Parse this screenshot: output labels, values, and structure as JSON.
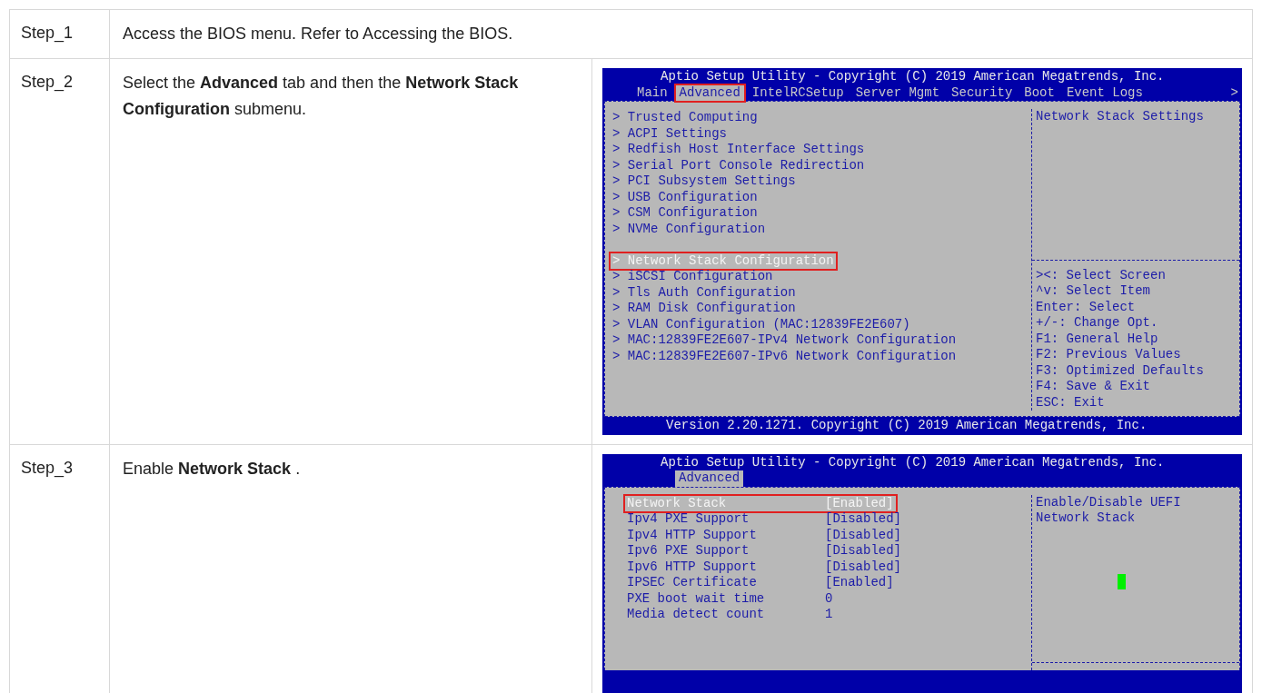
{
  "steps": [
    {
      "label": "Step_1",
      "text": "Access the BIOS menu. Refer to Accessing the BIOS."
    },
    {
      "label": "Step_2",
      "text": "Select the **Advanced** tab and then the **Network Stack Configuration** submenu.",
      "screen": {
        "kind": "menu",
        "title": "Aptio Setup Utility - Copyright (C) 2019 American Megatrends, Inc.",
        "tabs": [
          {
            "label": "Main",
            "selected": false,
            "marked": false
          },
          {
            "label": "Advanced",
            "selected": true,
            "marked": true
          },
          {
            "label": "IntelRCSetup",
            "selected": false,
            "marked": false
          },
          {
            "label": "Server Mgmt",
            "selected": false,
            "marked": false
          },
          {
            "label": "Security",
            "selected": false,
            "marked": false
          },
          {
            "label": "Boot",
            "selected": false,
            "marked": false
          },
          {
            "label": "Event Logs",
            "selected": false,
            "marked": false
          }
        ],
        "more_tabs": ">",
        "items": [
          {
            "kind": "submenu",
            "label": "> Trusted Computing",
            "selected": false,
            "marked": false
          },
          {
            "kind": "submenu",
            "label": "> ACPI Settings",
            "selected": false,
            "marked": false
          },
          {
            "kind": "submenu",
            "label": "> Redfish Host Interface Settings",
            "selected": false,
            "marked": false
          },
          {
            "kind": "submenu",
            "label": "> Serial Port Console Redirection",
            "selected": false,
            "marked": false
          },
          {
            "kind": "submenu",
            "label": "> PCI Subsystem Settings",
            "selected": false,
            "marked": false
          },
          {
            "kind": "submenu",
            "label": "> USB Configuration",
            "selected": false,
            "marked": false
          },
          {
            "kind": "submenu",
            "label": "> CSM Configuration",
            "selected": false,
            "marked": false
          },
          {
            "kind": "submenu",
            "label": "> NVMe Configuration",
            "selected": false,
            "marked": false
          },
          {
            "kind": "spacer"
          },
          {
            "kind": "submenu",
            "label": "> Network Stack Configuration",
            "selected": true,
            "marked": true
          },
          {
            "kind": "submenu",
            "label": "> iSCSI Configuration",
            "selected": false,
            "marked": false
          },
          {
            "kind": "submenu",
            "label": "> Tls Auth Configuration",
            "selected": false,
            "marked": false
          },
          {
            "kind": "submenu",
            "label": "> RAM Disk Configuration",
            "selected": false,
            "marked": false
          },
          {
            "kind": "submenu",
            "label": "> VLAN Configuration (MAC:12839FE2E607)",
            "selected": false,
            "marked": false
          },
          {
            "kind": "submenu",
            "label": "> MAC:12839FE2E607-IPv4 Network Configuration",
            "selected": false,
            "marked": false
          },
          {
            "kind": "submenu",
            "label": "> MAC:12839FE2E607-IPv6 Network Configuration",
            "selected": false,
            "marked": false
          }
        ],
        "help": [
          "Network Stack Settings"
        ],
        "keys": [
          "><: Select Screen",
          "^v: Select Item",
          "Enter: Select",
          "+/-: Change Opt.",
          "F1: General Help",
          "F2: Previous Values",
          "F3: Optimized Defaults",
          "F4: Save & Exit",
          "ESC: Exit"
        ],
        "footer": "Version 2.20.1271. Copyright (C) 2019 American Megatrends, Inc."
      }
    },
    {
      "label": "Step_3",
      "text": "Enable **Network Stack** .",
      "screen": {
        "kind": "settings",
        "title": "Aptio Setup Utility - Copyright (C) 2019 American Megatrends, Inc.",
        "tabs": [
          {
            "label": "Advanced",
            "selected": true,
            "marked": false
          }
        ],
        "items": [
          {
            "kind": "setting",
            "label": "Network Stack",
            "value": "[Enabled]",
            "selected": true,
            "marked": true
          },
          {
            "kind": "setting",
            "label": "Ipv4 PXE Support",
            "value": "[Disabled]",
            "selected": false,
            "marked": false
          },
          {
            "kind": "setting",
            "label": "Ipv4 HTTP Support",
            "value": "[Disabled]",
            "selected": false,
            "marked": false
          },
          {
            "kind": "setting",
            "label": "Ipv6 PXE Support",
            "value": "[Disabled]",
            "selected": false,
            "marked": false
          },
          {
            "kind": "setting",
            "label": "Ipv6 HTTP Support",
            "value": "[Disabled]",
            "selected": false,
            "marked": false
          },
          {
            "kind": "setting",
            "label": "IPSEC Certificate",
            "value": "[Enabled]",
            "selected": false,
            "marked": false
          },
          {
            "kind": "setting",
            "label": "PXE boot wait time",
            "value": "0",
            "selected": false,
            "marked": false
          },
          {
            "kind": "setting",
            "label": "Media detect count",
            "value": "1",
            "selected": false,
            "marked": false
          }
        ],
        "help": [
          "Enable/Disable UEFI",
          "Network Stack"
        ]
      }
    }
  ]
}
